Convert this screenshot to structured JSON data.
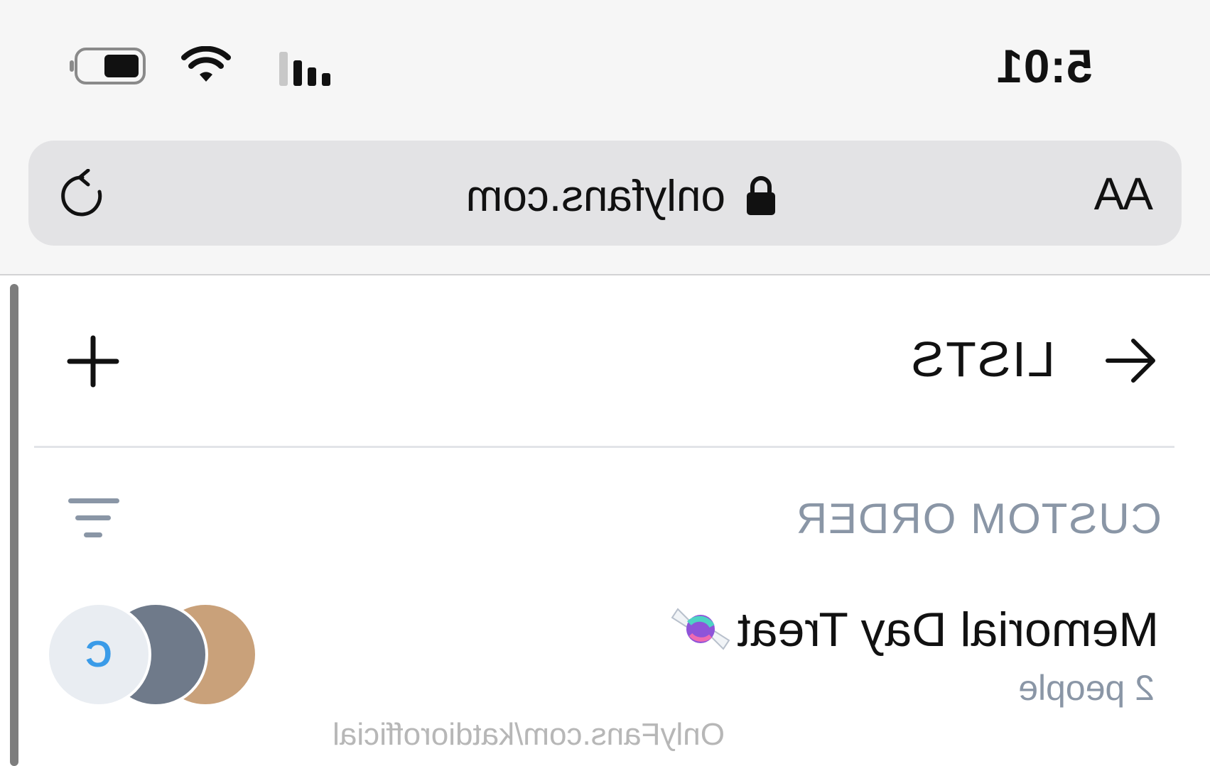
{
  "status_bar": {
    "time": "5:01"
  },
  "browser": {
    "text_size_label": "AA",
    "url": "onlyfans.com"
  },
  "lists_page": {
    "title": "LISTS",
    "sort_label": "CUSTOM ORDER",
    "items": [
      {
        "name": "Memorial Day Treat",
        "count": "2 people",
        "avatar_initial": "C"
      }
    ]
  },
  "watermark": "OnlyFans.com/katdiorofficial",
  "icons": {
    "battery": "battery-icon",
    "wifi": "wifi-icon",
    "signal": "signal-icon",
    "lock": "lock-icon",
    "reload": "reload-icon",
    "back": "arrow-left-icon",
    "add": "plus-icon",
    "sort": "sort-icon",
    "candy": "candy-icon"
  },
  "colors": {
    "accent_initial": "#3a9be8",
    "muted_text": "#8a96a6"
  }
}
